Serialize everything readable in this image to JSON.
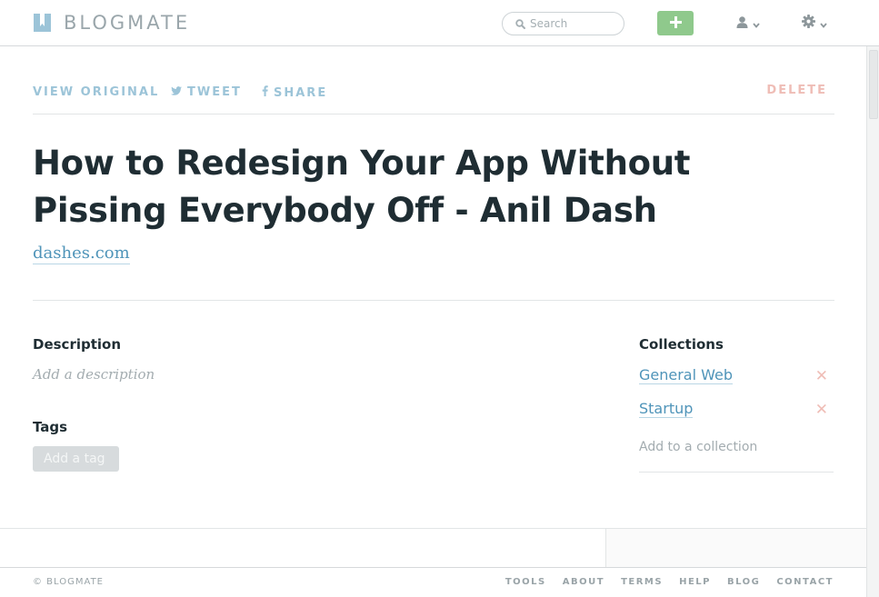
{
  "header": {
    "logo_text": "BLOGMATE",
    "logo_icon": "bookmark-icon",
    "search_placeholder": "Search",
    "add_icon": "plus-icon",
    "user_icon": "user-icon",
    "settings_icon": "gear-icon",
    "colors": {
      "add_button": "#8fc98c",
      "logo": "#9aa6ab"
    }
  },
  "actions": {
    "view_original": "VIEW ORIGINAL",
    "tweet": "TWEET",
    "share": "SHARE",
    "delete": "DELETE",
    "colors": {
      "link": "#9cc4d8",
      "delete": "#efbdb6"
    }
  },
  "article": {
    "title": "How to Redesign Your App Without Pissing Everybody Off - Anil Dash",
    "domain": "dashes.com"
  },
  "description": {
    "heading": "Description",
    "placeholder": "Add a description"
  },
  "tags": {
    "heading": "Tags",
    "add_label": "Add a tag"
  },
  "collections": {
    "heading": "Collections",
    "items": [
      {
        "label": "General Web",
        "remove": "✕"
      },
      {
        "label": "Startup",
        "remove": "✕"
      }
    ],
    "add_label": "Add to a collection"
  },
  "footer": {
    "copyright": "© BLOGMATE",
    "links": [
      "TOOLS",
      "ABOUT",
      "TERMS",
      "HELP",
      "BLOG",
      "CONTACT"
    ]
  }
}
